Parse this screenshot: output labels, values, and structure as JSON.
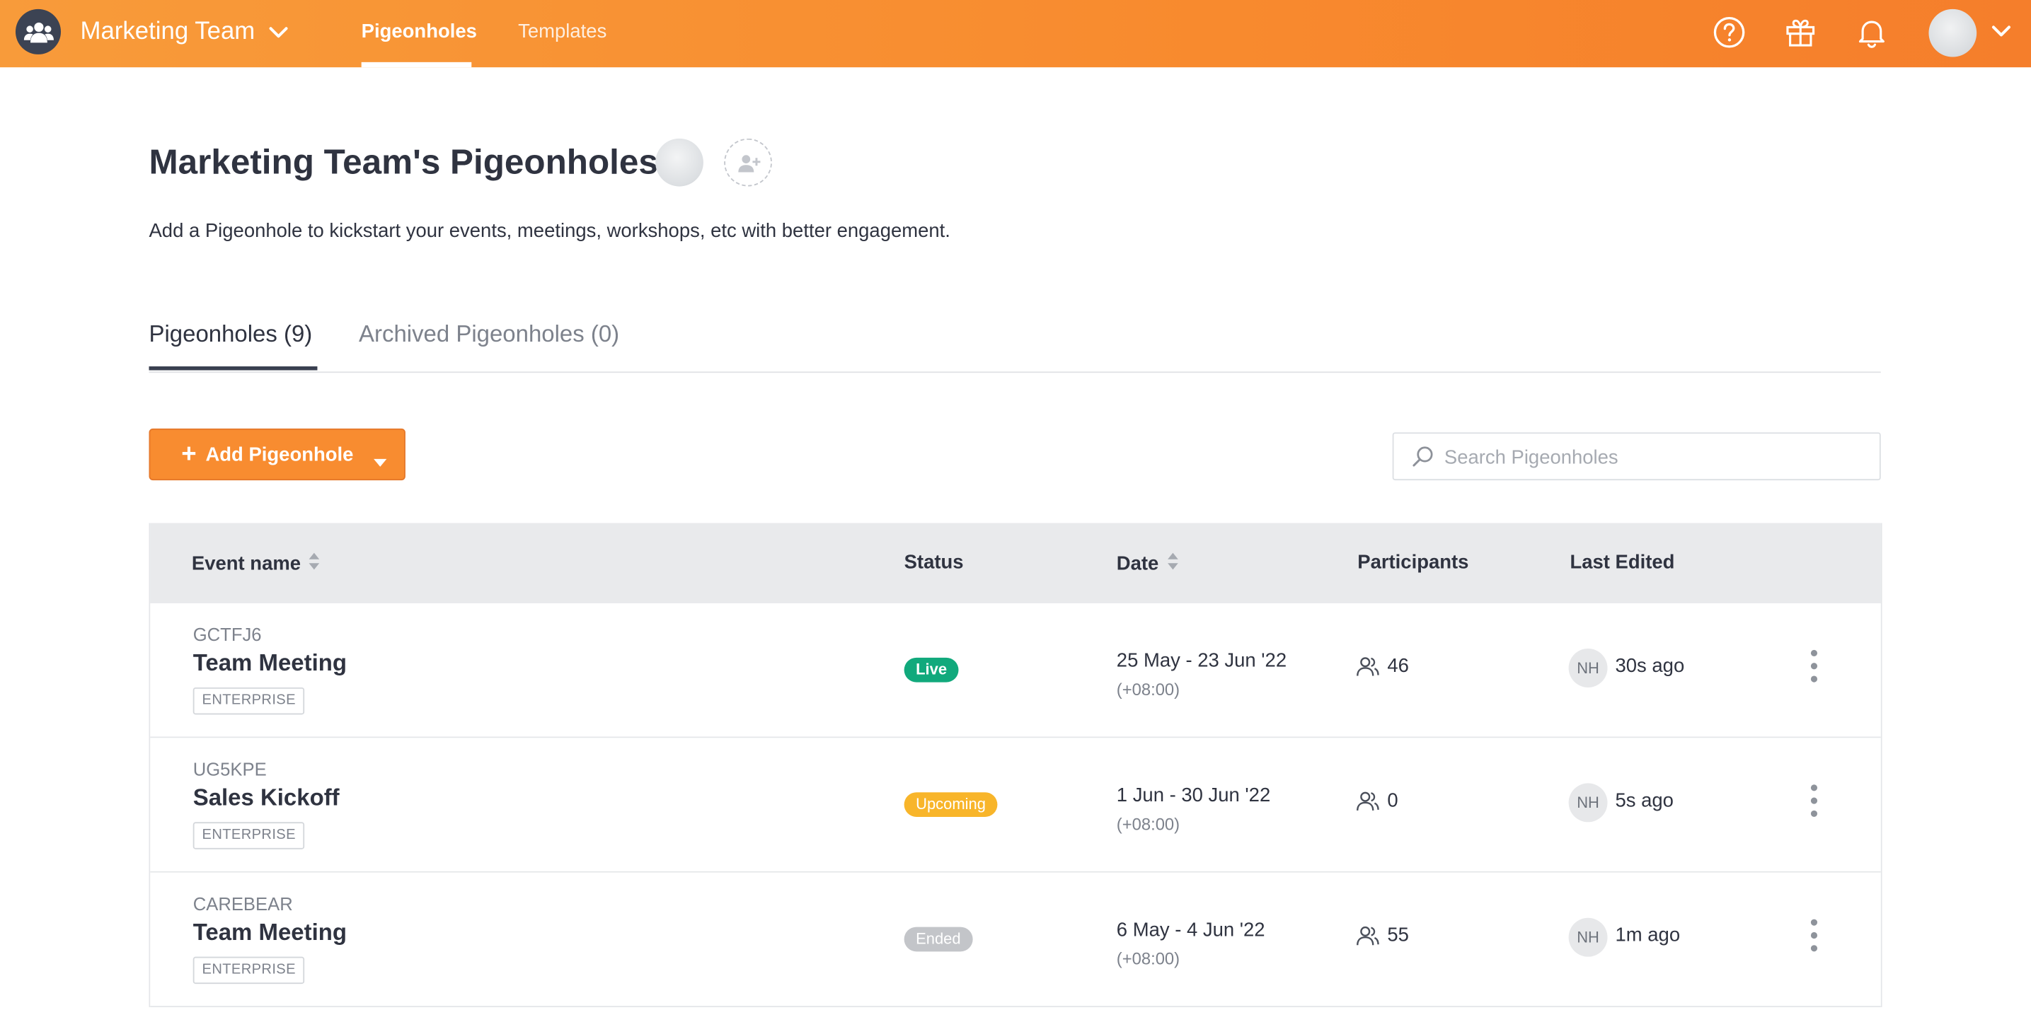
{
  "topbar": {
    "team_name": "Marketing Team",
    "nav_tabs": [
      {
        "label": "Pigeonholes",
        "active": true
      },
      {
        "label": "Templates",
        "active": false
      }
    ],
    "icons": [
      "help-icon",
      "gift-icon",
      "bell-icon"
    ],
    "accent_color": "#f88a2e"
  },
  "header": {
    "title": "Marketing Team's Pigeonholes",
    "subtitle": "Add a Pigeonhole to kickstart your events, meetings, workshops, etc with better engagement."
  },
  "tabs": [
    {
      "label": "Pigeonholes (9)",
      "active": true
    },
    {
      "label": "Archived Pigeonholes (0)",
      "active": false
    }
  ],
  "actions": {
    "add_label": "Add Pigeonhole",
    "search_placeholder": "Search Pigeonholes",
    "search_value": ""
  },
  "table": {
    "columns": {
      "event_name": "Event name",
      "status": "Status",
      "date": "Date",
      "participants": "Participants",
      "last_edited": "Last Edited"
    },
    "rows": [
      {
        "code": "GCTFJ6",
        "name": "Team Meeting",
        "plan": "ENTERPRISE",
        "status": "Live",
        "status_kind": "live",
        "date": "25 May - 23 Jun '22",
        "timezone": "(+08:00)",
        "participants": "46",
        "editor_initials": "NH",
        "last_edited": "30s ago"
      },
      {
        "code": "UG5KPE",
        "name": "Sales Kickoff",
        "plan": "ENTERPRISE",
        "status": "Upcoming",
        "status_kind": "upcoming",
        "date": "1 Jun - 30 Jun '22",
        "timezone": "(+08:00)",
        "participants": "0",
        "editor_initials": "NH",
        "last_edited": "5s ago"
      },
      {
        "code": "CAREBEAR",
        "name": "Team Meeting",
        "plan": "ENTERPRISE",
        "status": "Ended",
        "status_kind": "ended",
        "date": "6 May - 4 Jun '22",
        "timezone": "(+08:00)",
        "participants": "55",
        "editor_initials": "NH",
        "last_edited": "1m ago"
      }
    ]
  },
  "status_colors": {
    "live": "#11a97c",
    "upcoming": "#f8b52a",
    "ended": "#c3c5c9"
  }
}
